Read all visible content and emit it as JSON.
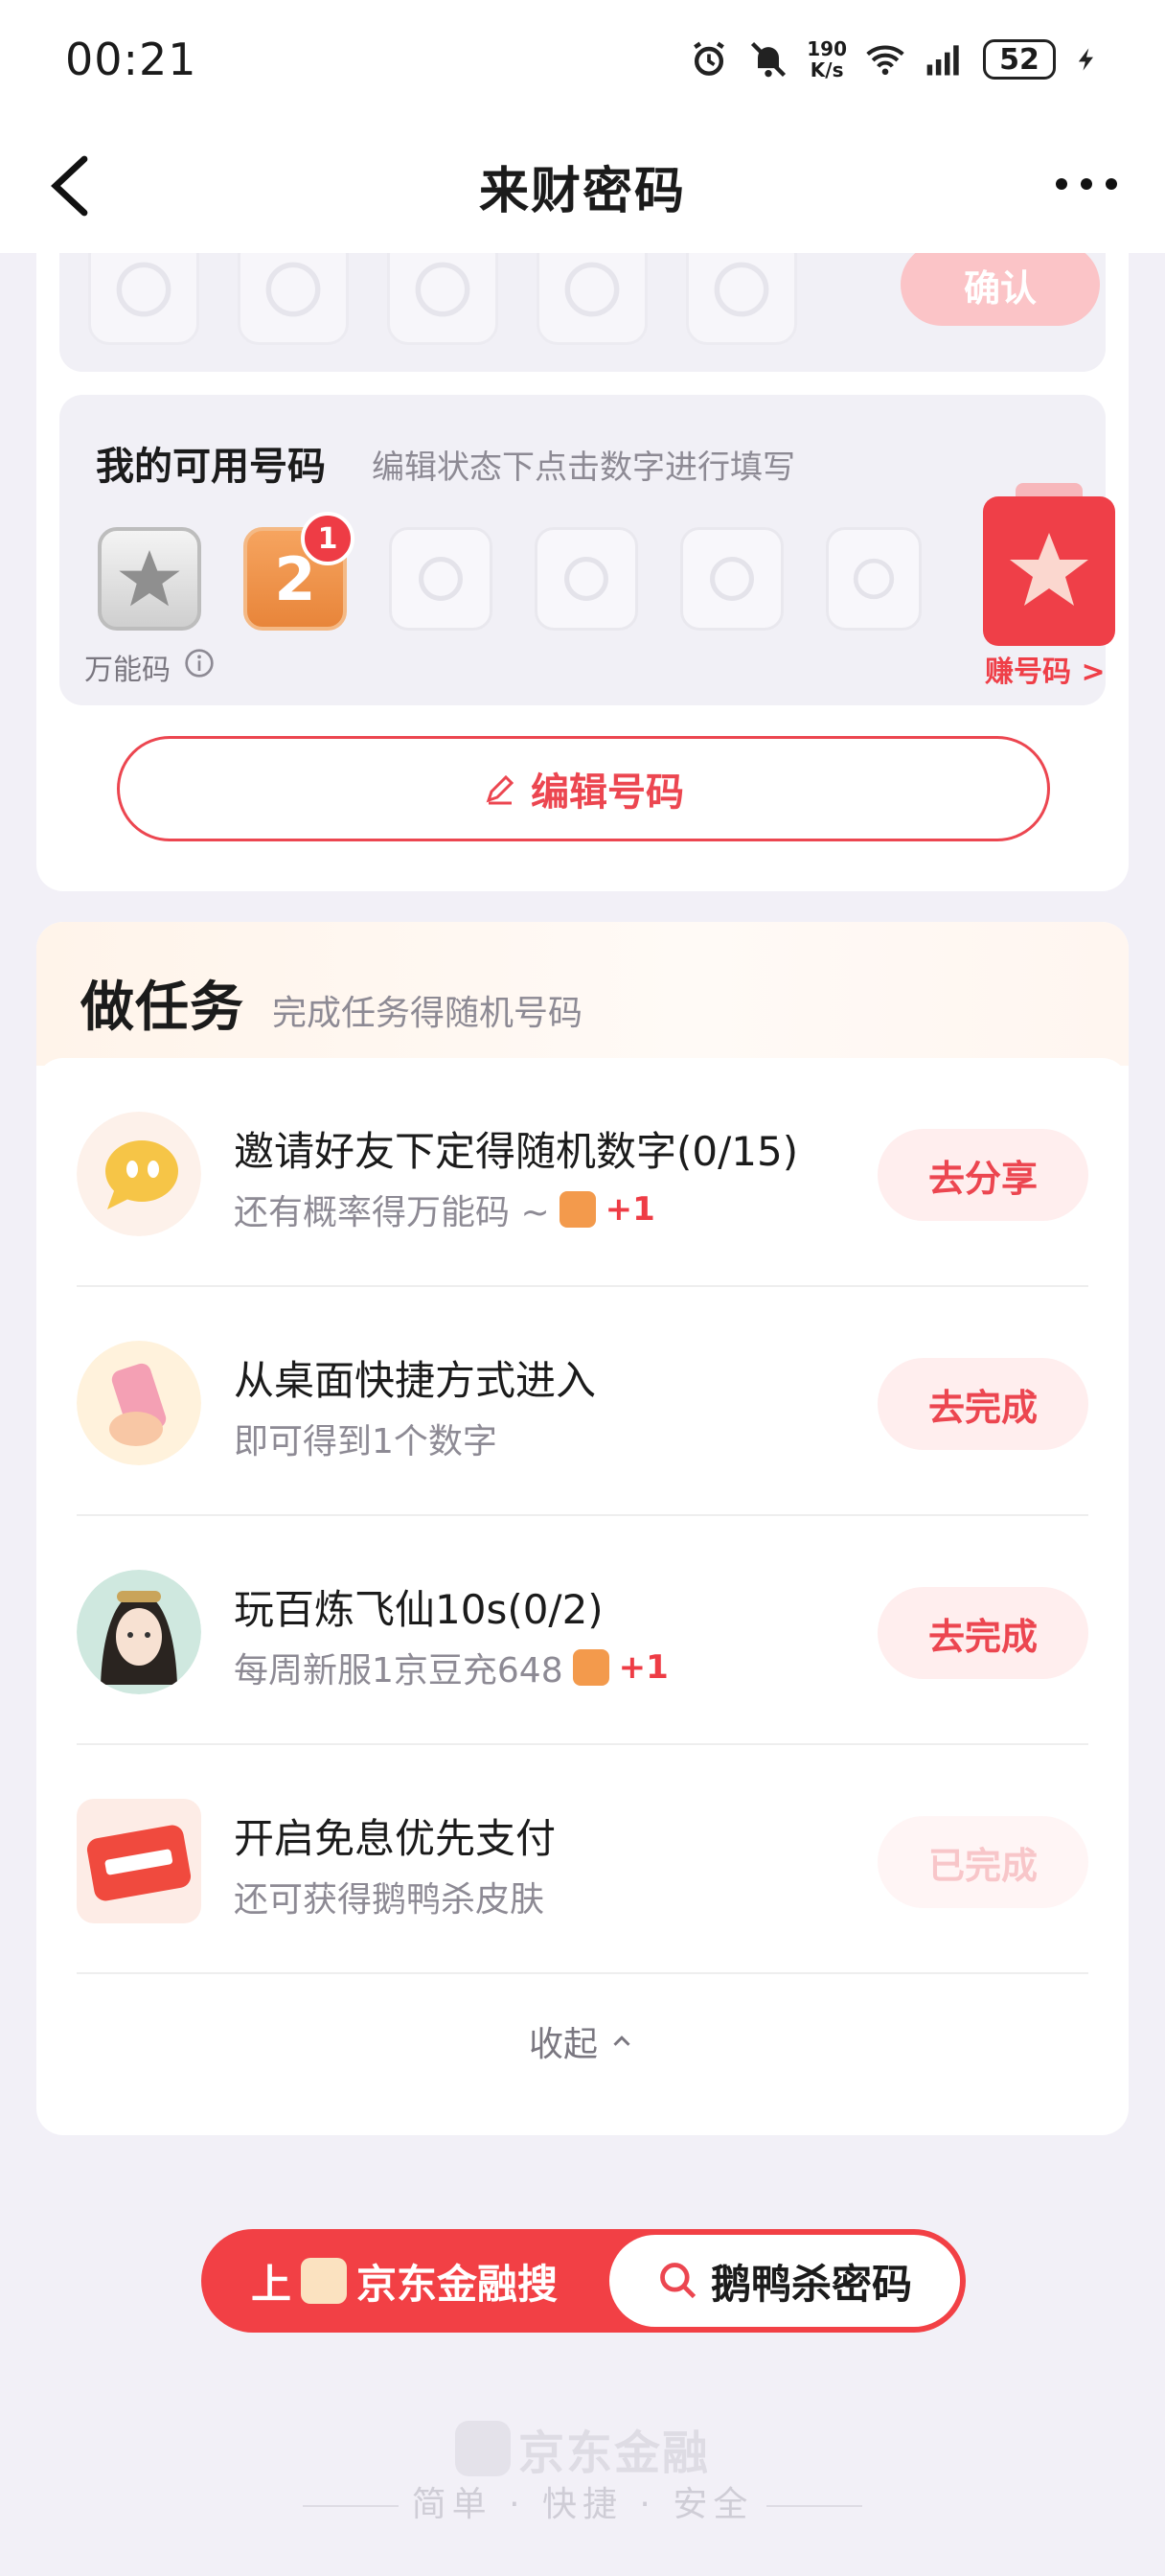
{
  "status_bar": {
    "time": "00:21",
    "net_speed_value": "190",
    "net_speed_unit": "K/s",
    "battery": "52"
  },
  "nav": {
    "title": "来财密码"
  },
  "top_card": {
    "confirm_label": "确认",
    "my_codes_title": "我的可用号码",
    "my_codes_hint": "编辑状态下点击数字进行填写",
    "number_slot_value": "2",
    "number_slot_badge": "1",
    "wild_label": "万能码",
    "earn_label": "赚号码 >",
    "edit_button": "编辑号码"
  },
  "tasks": {
    "title": "做任务",
    "subtitle": "完成任务得随机号码",
    "items": [
      {
        "name": "邀请好友下定得随机数字(0/15)",
        "desc": "还有概率得万能码 ~",
        "reward": "+1",
        "button": "去分享",
        "icon": "chat-bubble-icon",
        "done": false
      },
      {
        "name": "从桌面快捷方式进入",
        "desc": "即可得到1个数字",
        "reward": "",
        "button": "去完成",
        "icon": "phone-hand-icon",
        "done": false
      },
      {
        "name": "玩百炼飞仙10s(0/2)",
        "desc": "每周新服1京豆充648",
        "reward": "+1",
        "button": "去完成",
        "icon": "game-avatar-icon",
        "done": false
      },
      {
        "name": "开启免息优先支付",
        "desc": "还可获得鹅鸭杀皮肤",
        "reward": "",
        "button": "已完成",
        "icon": "interest-free-icon",
        "done": true
      }
    ],
    "collapse_label": "收起"
  },
  "search_banner": {
    "prefix": "上",
    "brand": "京东金融搜",
    "query": "鹅鸭杀密码"
  },
  "footer": {
    "logo_text": "京东金融",
    "slogan": "简单 · 快捷 · 安全"
  },
  "colors": {
    "accent": "#ec4650",
    "page_bg": "#f2f0f7",
    "orange": "#f39a4c"
  }
}
